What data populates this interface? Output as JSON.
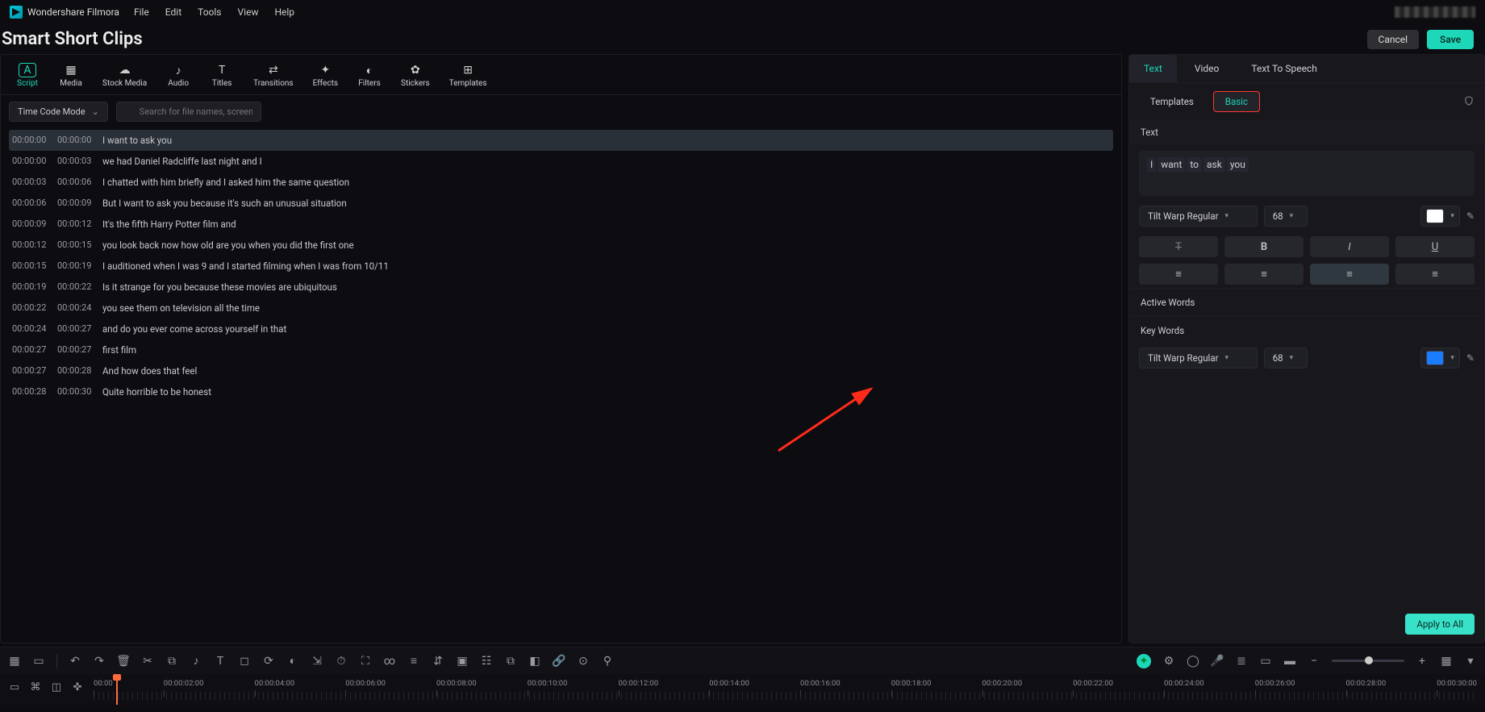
{
  "app_name": "Wondershare Filmora",
  "menu": [
    "File",
    "Edit",
    "Tools",
    "View",
    "Help"
  ],
  "page_title": "Smart Short Clips",
  "header_actions": {
    "cancel": "Cancel",
    "save": "Save"
  },
  "toolbar_tabs": [
    {
      "icon": "A",
      "label": "Script",
      "active": true
    },
    {
      "icon": "▦",
      "label": "Media"
    },
    {
      "icon": "☁",
      "label": "Stock Media"
    },
    {
      "icon": "♪",
      "label": "Audio"
    },
    {
      "icon": "T",
      "label": "Titles"
    },
    {
      "icon": "⇄",
      "label": "Transitions"
    },
    {
      "icon": "✦",
      "label": "Effects"
    },
    {
      "icon": "◐",
      "label": "Filters"
    },
    {
      "icon": "✿",
      "label": "Stickers"
    },
    {
      "icon": "⊞",
      "label": "Templates"
    }
  ],
  "mode_select": "Time Code Mode",
  "search_placeholder": "Search for file names, screen elements, lines",
  "transcript": [
    {
      "in": "00:00:00",
      "out": "00:00:00",
      "text": "I want to ask you",
      "selected": true
    },
    {
      "in": "00:00:00",
      "out": "00:00:03",
      "text": "we had Daniel Radcliffe last night and I"
    },
    {
      "in": "00:00:03",
      "out": "00:00:06",
      "text": "I chatted with him briefly and I asked him the same question"
    },
    {
      "in": "00:00:06",
      "out": "00:00:09",
      "text": "But I want to ask you because it's such an unusual situation"
    },
    {
      "in": "00:00:09",
      "out": "00:00:12",
      "text": "It's the fifth Harry Potter film and"
    },
    {
      "in": "00:00:12",
      "out": "00:00:15",
      "text": "you look back now how old are you when you did the first one"
    },
    {
      "in": "00:00:15",
      "out": "00:00:19",
      "text": "I auditioned when I was 9 and I started filming when I was from 10/11"
    },
    {
      "in": "00:00:19",
      "out": "00:00:22",
      "text": "Is it strange for you because these movies are ubiquitous"
    },
    {
      "in": "00:00:22",
      "out": "00:00:24",
      "text": "you see them on television all the time"
    },
    {
      "in": "00:00:24",
      "out": "00:00:27",
      "text": "and do you ever come across yourself in that"
    },
    {
      "in": "00:00:27",
      "out": "00:00:27",
      "text": "first film"
    },
    {
      "in": "00:00:27",
      "out": "00:00:28",
      "text": "And how does that feel"
    },
    {
      "in": "00:00:28",
      "out": "00:00:30",
      "text": "Quite horrible to be honest"
    }
  ],
  "right": {
    "tabs": [
      "Text",
      "Video",
      "Text To Speech"
    ],
    "active_tab": 0,
    "subtabs": {
      "templates": "Templates",
      "basic": "Basic"
    },
    "text_label": "Text",
    "words": [
      "I",
      "want",
      "to",
      "ask",
      "you"
    ],
    "font": "Tilt Warp Regular",
    "size": "68",
    "color_white": "#ffffff",
    "active_words": "Active Words",
    "key_words": "Key Words",
    "kw_font": "Tilt Warp Regular",
    "kw_size": "68",
    "color_blue": "#1a7dff",
    "apply": "Apply to All"
  },
  "timeline_marks": [
    "00:00",
    "00:00:02:00",
    "00:00:04:00",
    "00:00:06:00",
    "00:00:08:00",
    "00:00:10:00",
    "00:00:12:00",
    "00:00:14:00",
    "00:00:16:00",
    "00:00:18:00",
    "00:00:20:00",
    "00:00:22:00",
    "00:00:24:00",
    "00:00:26:00",
    "00:00:28:00",
    "00:00:30:00"
  ]
}
